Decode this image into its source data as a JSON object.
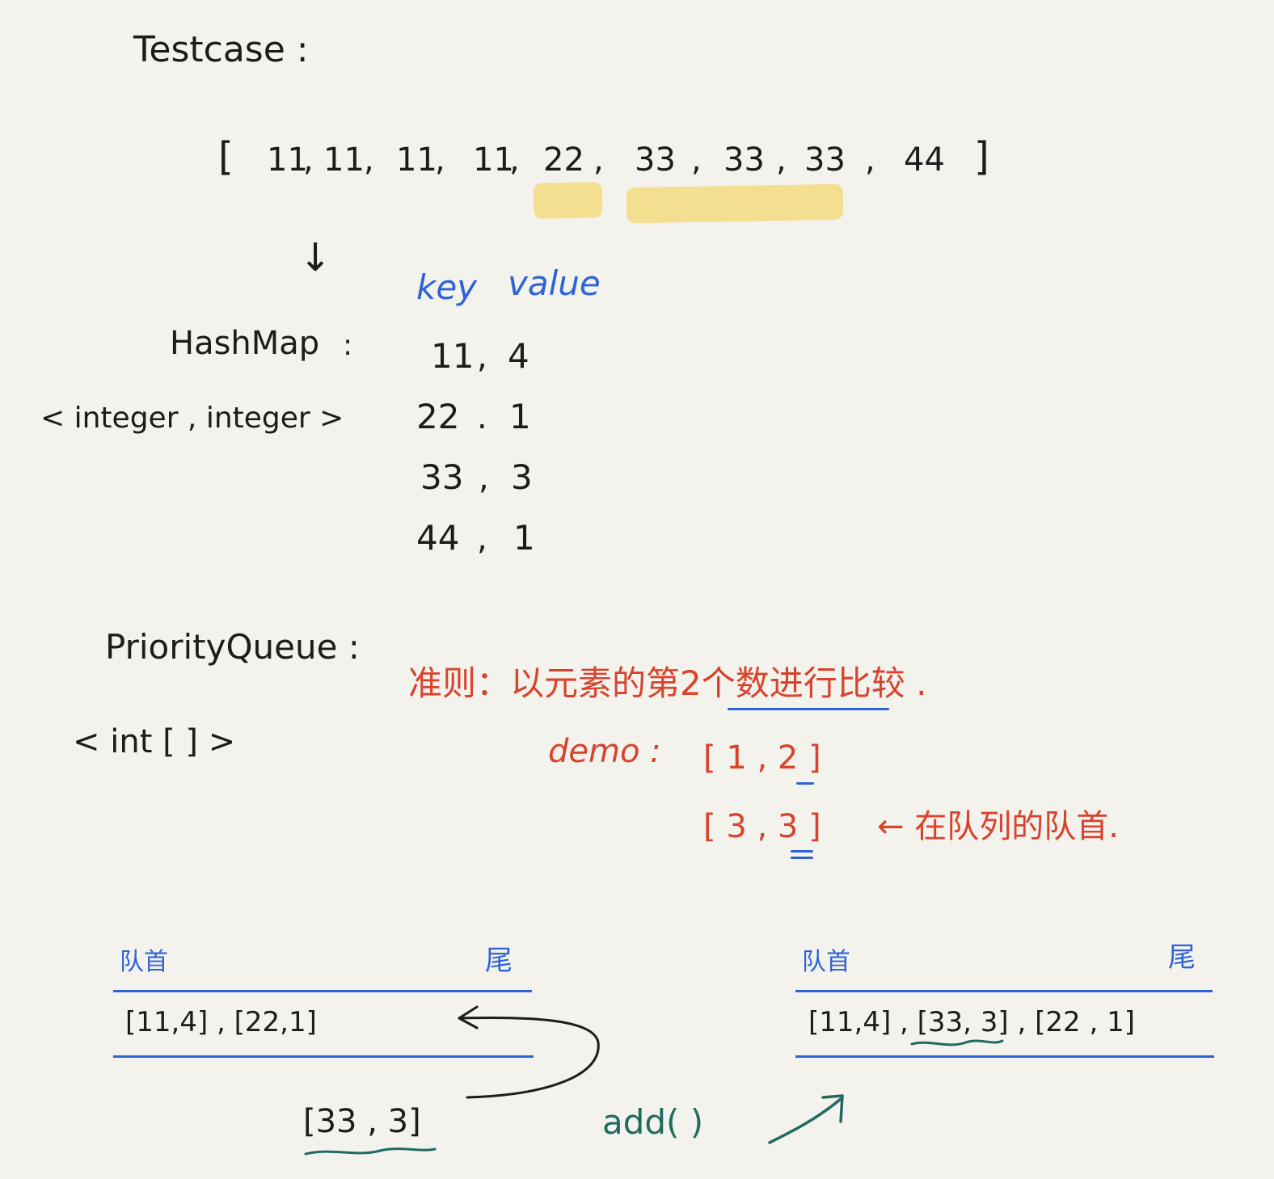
{
  "testcase": {
    "label": "Testcase :",
    "open_bracket": "[",
    "items": [
      "11",
      "11",
      "11",
      "11",
      "22",
      "33",
      "33",
      "33",
      "44"
    ],
    "close_bracket": "]",
    "down_arrow": "↓"
  },
  "hashmap": {
    "name": "HashMap",
    "colon": ":",
    "generic": "< integer , integer >",
    "key_header": "key",
    "value_header": "value",
    "entries": [
      {
        "key": "11",
        "value": "4"
      },
      {
        "key": "22",
        "value": "1"
      },
      {
        "key": "33",
        "value": "3"
      },
      {
        "key": "44",
        "value": "1"
      }
    ]
  },
  "priority_queue": {
    "name": "PriorityQueue :",
    "generic": "< int [ ] >",
    "rule": "准则：以元素的第2个数进行比较 .",
    "demo_label": "demo :",
    "demo_rows": [
      "[ 1 , 2 ]",
      "[ 3 , 3 ]"
    ],
    "head_note": "← 在队列的队首."
  },
  "queue_before": {
    "head_label": "队首",
    "tail_label": "尾",
    "contents": "[11,4] , [22,1]"
  },
  "queue_after": {
    "head_label": "队首",
    "tail_label": "尾",
    "contents": "[11,4] , [33, 3] , [22 , 1]"
  },
  "new_element": "[33 , 3]",
  "add_label": "add( )",
  "colors": {
    "ink": "#1c1c1c",
    "blue": "#2e63d8",
    "red": "#d8432d",
    "teal": "#1f6b62",
    "highlight": "#f4d35e",
    "paper": "#f3f2ec"
  }
}
